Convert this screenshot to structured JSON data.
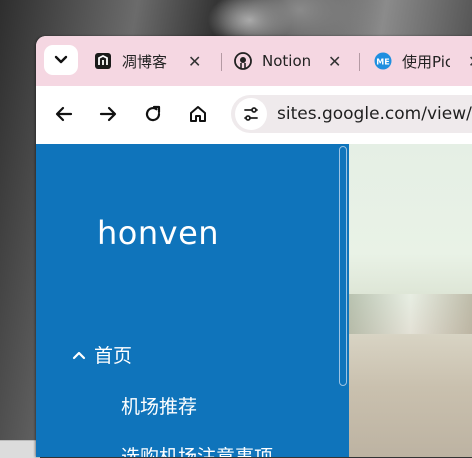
{
  "browser": {
    "tabs": [
      {
        "label": "凋博客",
        "icon": "site-icon"
      },
      {
        "label": "Notion",
        "icon": "github-icon"
      },
      {
        "label": "使用Pic",
        "icon": "me-icon"
      }
    ],
    "close_glyph": "✕",
    "url": "sites.google.com/view/"
  },
  "site": {
    "title": "honven",
    "nav": {
      "home": "首页",
      "sub1": "机场推荐",
      "sub2": "选购机场注意事项"
    }
  },
  "colors": {
    "tabstrip": "#f5d7e2",
    "sidebar": "#0f74bb",
    "omnibox": "#efeaec"
  }
}
